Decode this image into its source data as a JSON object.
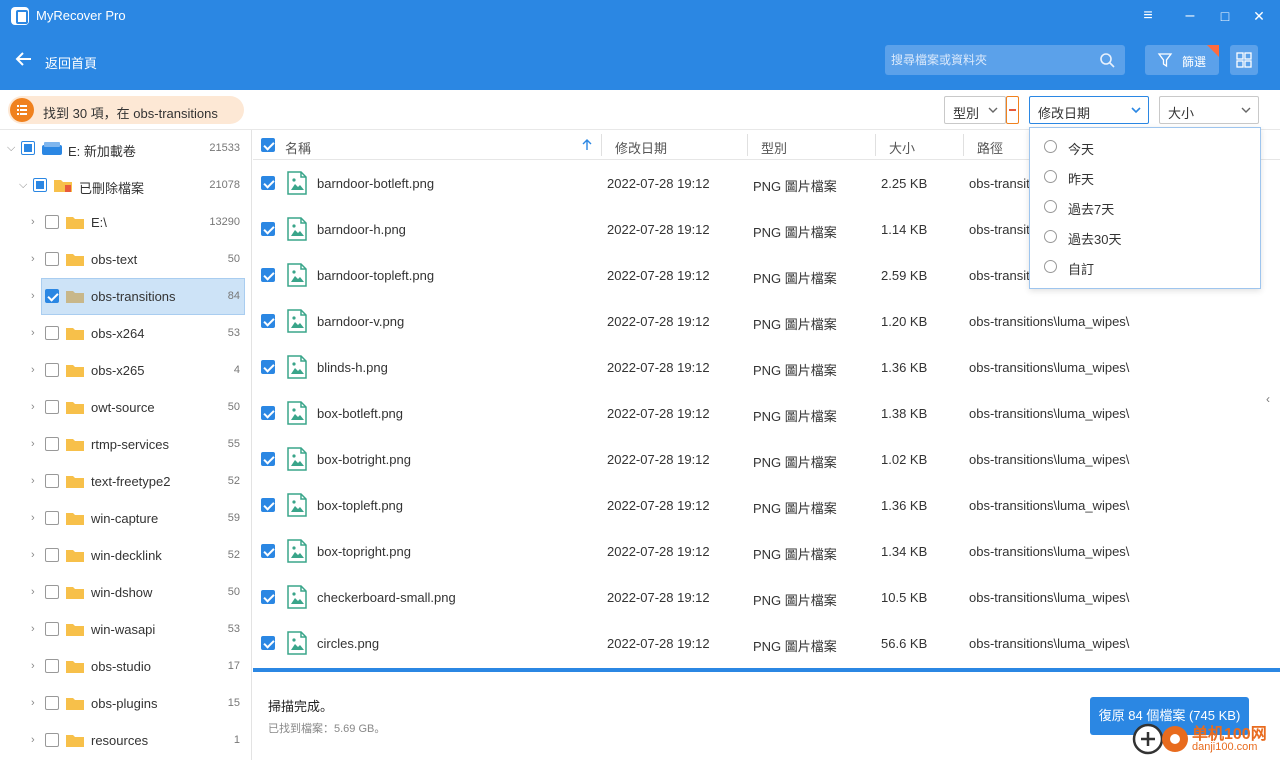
{
  "app": {
    "title": "MyRecover Pro"
  },
  "window_controls": {
    "menu": "≡",
    "minimize": "–",
    "maximize": "□",
    "close": "✕"
  },
  "nav": {
    "back_label": "返回首頁",
    "search_placeholder": "搜尋檔案或資料夾",
    "filter_label": "篩選"
  },
  "toolbar": {
    "found_text": "找到 30 項，在 obs-transitions",
    "type_filter": "型別",
    "date_filter": "修改日期",
    "size_filter": "大小"
  },
  "date_menu": {
    "options": [
      "今天",
      "昨天",
      "過去7天",
      "過去30天",
      "自訂"
    ]
  },
  "tree": {
    "root": {
      "label": "E: 新加載卷",
      "count": "21533"
    },
    "deleted": {
      "label": "已刪除檔案",
      "count": "21078"
    },
    "folders": [
      {
        "label": "E:\\",
        "count": "13290"
      },
      {
        "label": "obs-text",
        "count": "50"
      },
      {
        "label": "obs-transitions",
        "count": "84"
      },
      {
        "label": "obs-x264",
        "count": "53"
      },
      {
        "label": "obs-x265",
        "count": "4"
      },
      {
        "label": "owt-source",
        "count": "50"
      },
      {
        "label": "rtmp-services",
        "count": "55"
      },
      {
        "label": "text-freetype2",
        "count": "52"
      },
      {
        "label": "win-capture",
        "count": "59"
      },
      {
        "label": "win-decklink",
        "count": "52"
      },
      {
        "label": "win-dshow",
        "count": "50"
      },
      {
        "label": "win-wasapi",
        "count": "53"
      },
      {
        "label": "obs-studio",
        "count": "17"
      },
      {
        "label": "obs-plugins",
        "count": "15"
      },
      {
        "label": "resources",
        "count": "1"
      }
    ]
  },
  "table": {
    "headers": {
      "name": "名稱",
      "date": "修改日期",
      "type": "型別",
      "size": "大小",
      "path": "路徑"
    },
    "rows": [
      {
        "name": "barndoor-botleft.png",
        "date": "2022-07-28 19:12",
        "type": "PNG 圖片檔案",
        "size": "2.25 KB",
        "path": "obs-transitions\\luma_wipes\\"
      },
      {
        "name": "barndoor-h.png",
        "date": "2022-07-28 19:12",
        "type": "PNG 圖片檔案",
        "size": "1.14 KB",
        "path": "obs-transitions\\luma_wipes\\"
      },
      {
        "name": "barndoor-topleft.png",
        "date": "2022-07-28 19:12",
        "type": "PNG 圖片檔案",
        "size": "2.59 KB",
        "path": "obs-transitions\\luma_wipes\\"
      },
      {
        "name": "barndoor-v.png",
        "date": "2022-07-28 19:12",
        "type": "PNG 圖片檔案",
        "size": "1.20 KB",
        "path": "obs-transitions\\luma_wipes\\"
      },
      {
        "name": "blinds-h.png",
        "date": "2022-07-28 19:12",
        "type": "PNG 圖片檔案",
        "size": "1.36 KB",
        "path": "obs-transitions\\luma_wipes\\"
      },
      {
        "name": "box-botleft.png",
        "date": "2022-07-28 19:12",
        "type": "PNG 圖片檔案",
        "size": "1.38 KB",
        "path": "obs-transitions\\luma_wipes\\"
      },
      {
        "name": "box-botright.png",
        "date": "2022-07-28 19:12",
        "type": "PNG 圖片檔案",
        "size": "1.02 KB",
        "path": "obs-transitions\\luma_wipes\\"
      },
      {
        "name": "box-topleft.png",
        "date": "2022-07-28 19:12",
        "type": "PNG 圖片檔案",
        "size": "1.36 KB",
        "path": "obs-transitions\\luma_wipes\\"
      },
      {
        "name": "box-topright.png",
        "date": "2022-07-28 19:12",
        "type": "PNG 圖片檔案",
        "size": "1.34 KB",
        "path": "obs-transitions\\luma_wipes\\"
      },
      {
        "name": "checkerboard-small.png",
        "date": "2022-07-28 19:12",
        "type": "PNG 圖片檔案",
        "size": "10.5 KB",
        "path": "obs-transitions\\luma_wipes\\"
      },
      {
        "name": "circles.png",
        "date": "2022-07-28 19:12",
        "type": "PNG 圖片檔案",
        "size": "56.6 KB",
        "path": "obs-transitions\\luma_wipes\\"
      }
    ]
  },
  "bottom": {
    "status_title": "掃描完成。",
    "status_sub": "已找到檔案：5.69 GB。",
    "recover_label": "復原 84 個檔案 (745 KB)"
  },
  "watermark": {
    "title": "单机100网",
    "url": "danji100.com"
  },
  "colors": {
    "accent": "#2b87e3",
    "orange": "#f0811e",
    "folder": "#f7c04a"
  }
}
